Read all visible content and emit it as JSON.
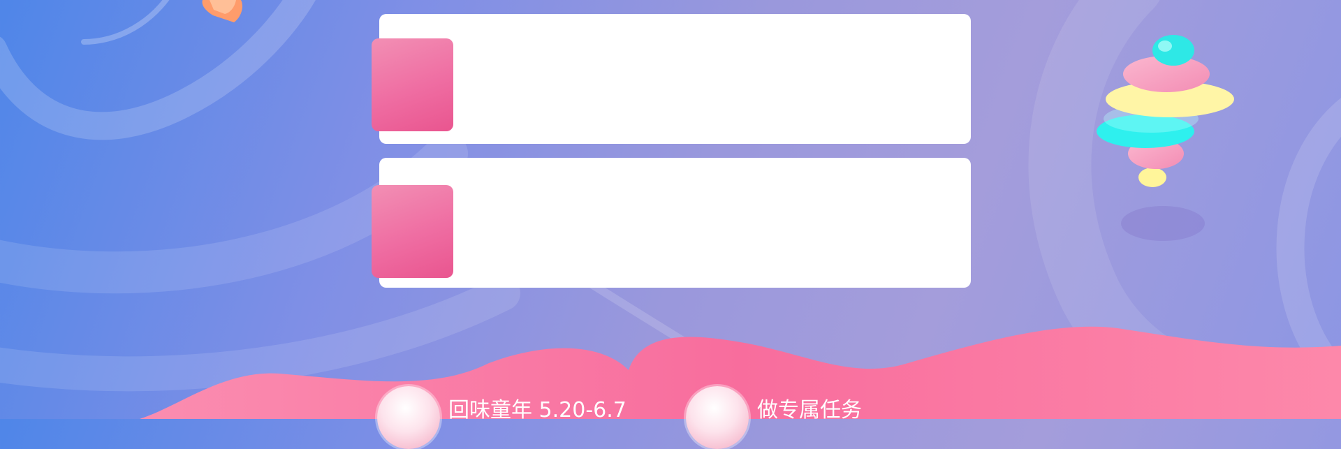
{
  "colors": {
    "background_start": "#4f86e8",
    "background_end": "#a49ddb",
    "wave_pink": "#f9749f",
    "card_white": "#ffffff",
    "thumb_pink": "#ef6da2"
  },
  "cards": [
    {
      "id": "card-1",
      "title": "",
      "icon": "pink-thumbnail"
    },
    {
      "id": "card-2",
      "title": "",
      "icon": "pink-thumbnail"
    }
  ],
  "footer": {
    "items": [
      {
        "label": "回味童年 5.20-6.7",
        "icon": "candy-badge-icon"
      },
      {
        "label": "做专属任务",
        "icon": "candy-badge-icon"
      }
    ]
  },
  "decorations": [
    "swirl-lines",
    "marshmallow-twist-icon",
    "candy-corner-icon",
    "pink-wave"
  ]
}
